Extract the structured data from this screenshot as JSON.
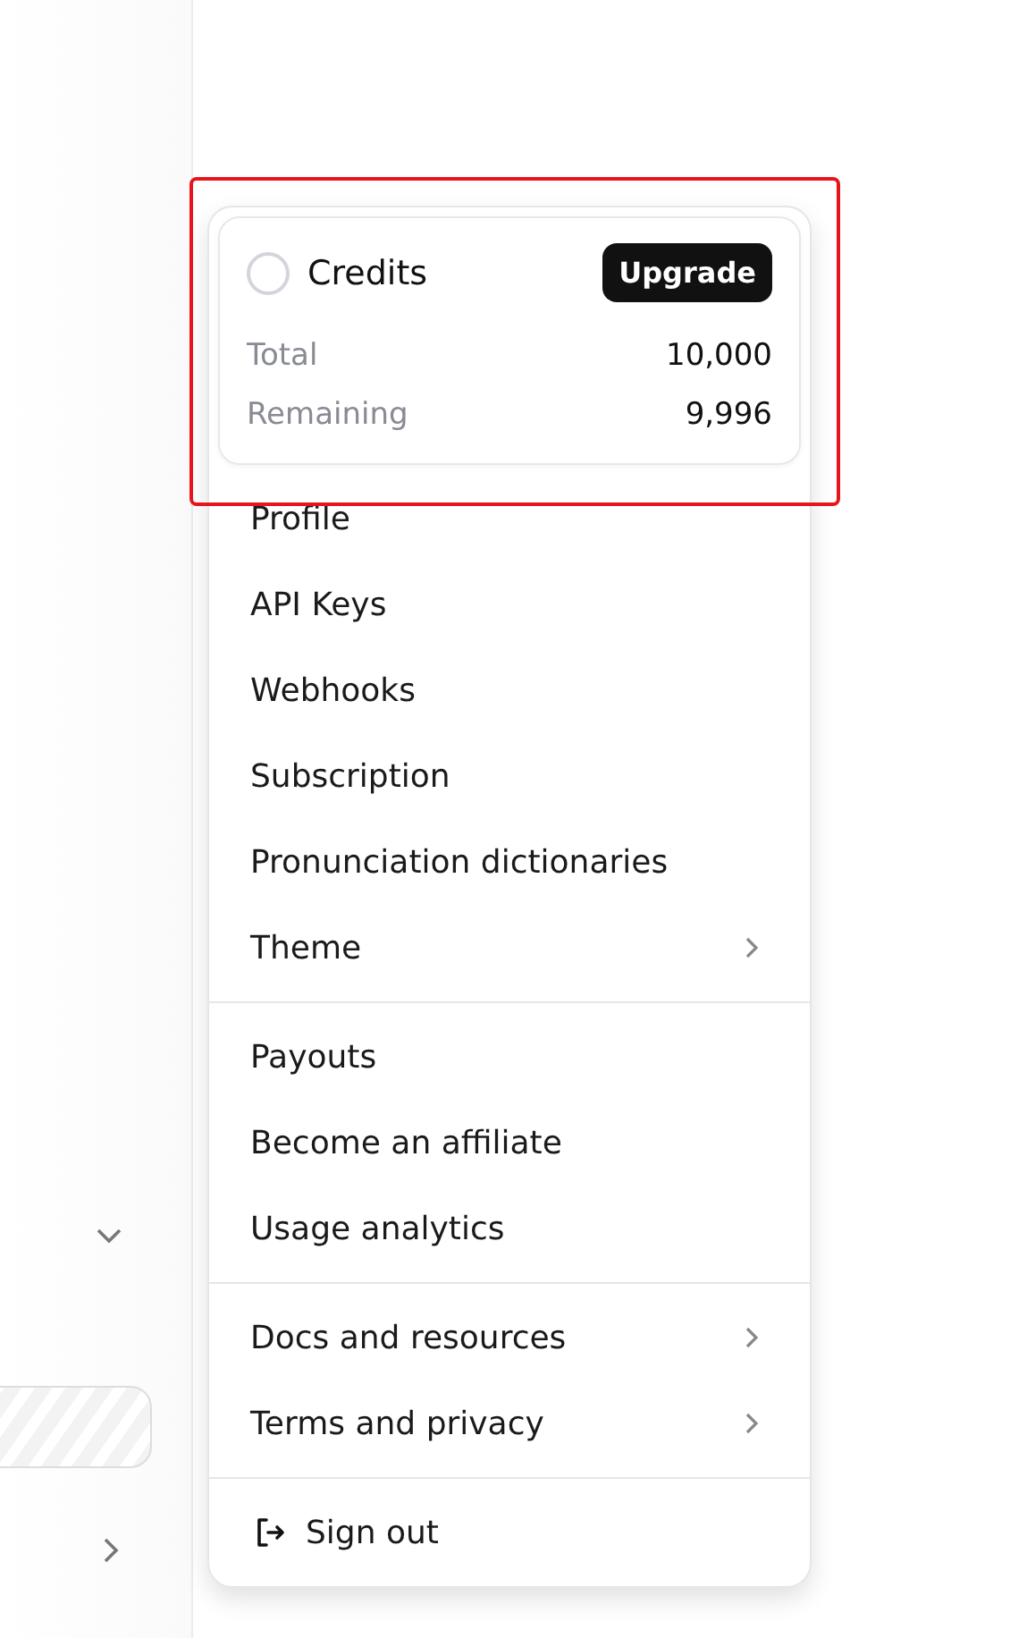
{
  "credits": {
    "title": "Credits",
    "highlighted": true,
    "button": "Upgrade",
    "rows": [
      {
        "label": "Total",
        "value": "10,000"
      },
      {
        "label": "Remaining",
        "value": "9,996"
      }
    ]
  },
  "menu": {
    "sections": [
      {
        "items": [
          {
            "label": "Profile",
            "kind": "link"
          },
          {
            "label": "API Keys",
            "kind": "link"
          },
          {
            "label": "Webhooks",
            "kind": "link"
          },
          {
            "label": "Subscription",
            "kind": "link"
          },
          {
            "label": "Pronunciation dictionaries",
            "kind": "link"
          },
          {
            "label": "Theme",
            "kind": "submenu"
          }
        ]
      },
      {
        "items": [
          {
            "label": "Payouts",
            "kind": "link"
          },
          {
            "label": "Become an affiliate",
            "kind": "link"
          },
          {
            "label": "Usage analytics",
            "kind": "link"
          }
        ]
      },
      {
        "items": [
          {
            "label": "Docs and resources",
            "kind": "submenu"
          },
          {
            "label": "Terms and privacy",
            "kind": "submenu"
          }
        ]
      },
      {
        "items": [
          {
            "label": "Sign out",
            "kind": "signout"
          }
        ]
      }
    ]
  }
}
